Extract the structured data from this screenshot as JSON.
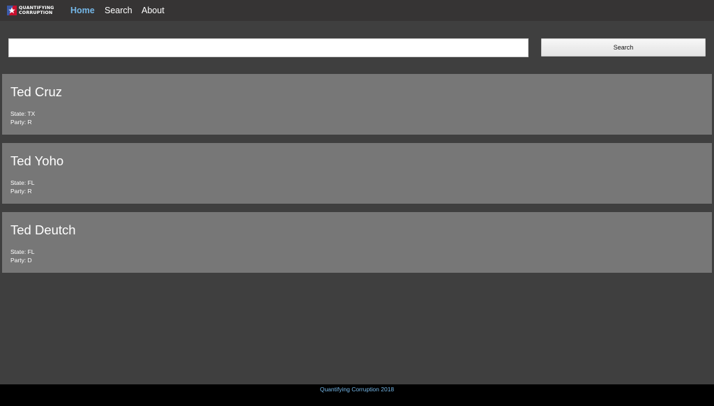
{
  "brand": {
    "line1": "QUANTIFYING",
    "line2": "CORRUPTION",
    "logo_icon": "star-flag-icon",
    "colors": {
      "blue": "#3b5aa8",
      "red": "#c8102e",
      "star": "#ffffff"
    }
  },
  "nav": {
    "items": [
      {
        "label": "Home",
        "active": true
      },
      {
        "label": "Search",
        "active": false
      },
      {
        "label": "About",
        "active": false
      }
    ],
    "active_color": "#74b6e6"
  },
  "search": {
    "value": "",
    "placeholder": "",
    "button_label": "Search"
  },
  "results": [
    {
      "name": "Ted Cruz",
      "state_label": "State: TX",
      "party_label": "Party: R"
    },
    {
      "name": "Ted Yoho",
      "state_label": "State: FL",
      "party_label": "Party: R"
    },
    {
      "name": "Ted Deutch",
      "state_label": "State: FL",
      "party_label": "Party: D"
    }
  ],
  "footer": {
    "text": "Quantifying Corruption 2018"
  },
  "colors": {
    "page_bg": "#3f3f3f",
    "navbar_bg": "#363434",
    "card_bg": "#777777",
    "footer_bg": "#000000"
  }
}
